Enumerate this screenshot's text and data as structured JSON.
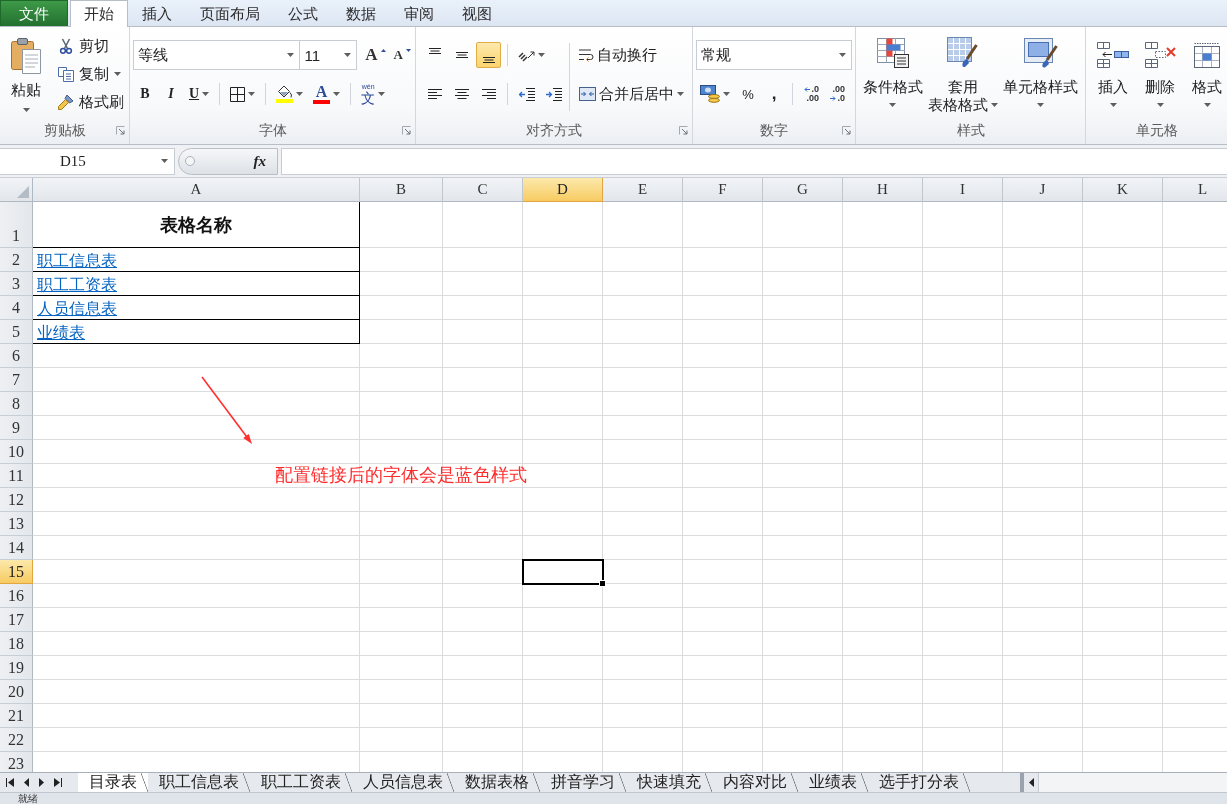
{
  "menu_tabs": [
    {
      "label": "文件",
      "kind": "file",
      "selected": false
    },
    {
      "label": "开始",
      "kind": "tab",
      "selected": true
    },
    {
      "label": "插入",
      "kind": "tab",
      "selected": false
    },
    {
      "label": "页面布局",
      "kind": "tab",
      "selected": false
    },
    {
      "label": "公式",
      "kind": "tab",
      "selected": false
    },
    {
      "label": "数据",
      "kind": "tab",
      "selected": false
    },
    {
      "label": "审阅",
      "kind": "tab",
      "selected": false
    },
    {
      "label": "视图",
      "kind": "tab",
      "selected": false
    }
  ],
  "ribbon": {
    "clipboard": {
      "label": "剪贴板",
      "paste": "粘贴",
      "small_buttons": [
        {
          "kind": "cut",
          "label": "剪切"
        },
        {
          "kind": "copy",
          "label": "复制",
          "dropdown": true
        },
        {
          "kind": "format_painter",
          "label": "格式刷"
        }
      ]
    },
    "font": {
      "label": "字体",
      "font_name": "等线",
      "font_size": "11",
      "size_buttons": [
        {
          "kind": "grow",
          "glyph": "A"
        },
        {
          "kind": "shrink",
          "glyph": "A"
        }
      ],
      "style_buttons": [
        {
          "kind": "bold",
          "glyph": "B"
        },
        {
          "kind": "italic",
          "glyph": "I"
        },
        {
          "kind": "underline",
          "glyph": "U",
          "dropdown": true
        }
      ],
      "color_buttons": [
        {
          "kind": "fill",
          "color": "#ffff00"
        },
        {
          "kind": "font",
          "glyph": "A",
          "color": "#ff0000"
        }
      ],
      "phonetic": {
        "ruby": "wén",
        "glyph": "文"
      }
    },
    "alignment": {
      "label": "对齐方式",
      "vertical": [
        {
          "kind": "top",
          "selected": false
        },
        {
          "kind": "middle",
          "selected": false
        },
        {
          "kind": "bottom",
          "selected": true
        }
      ],
      "horizontal": [
        {
          "kind": "left",
          "selected": false
        },
        {
          "kind": "center",
          "selected": false
        },
        {
          "kind": "right",
          "selected": false
        }
      ],
      "wrap_text": "自动换行",
      "merge_center": "合并后居中"
    },
    "number": {
      "label": "数字",
      "format": "常规",
      "symbol_buttons": [
        {
          "kind": "percent",
          "glyph": "%"
        },
        {
          "kind": "comma",
          "glyph": ","
        }
      ],
      "decimal_buttons": [
        {
          "kind": "increase",
          "lines": [
            ".0",
            ".00"
          ]
        },
        {
          "kind": "decrease",
          "lines": [
            ".00",
            ".0"
          ]
        }
      ]
    },
    "styles": {
      "label": "样式",
      "buttons": [
        {
          "kind": "conditional",
          "lines": [
            "条件格式"
          ],
          "dropdown": true
        },
        {
          "kind": "table",
          "lines": [
            "套用",
            "表格格式"
          ],
          "dropdown": true
        },
        {
          "kind": "cell_styles",
          "lines": [
            "单元格样式"
          ],
          "dropdown": true
        }
      ]
    },
    "cells": {
      "label": "单元格",
      "buttons": [
        {
          "kind": "insert",
          "lines": [
            "插入"
          ],
          "dropdown": true
        },
        {
          "kind": "delete",
          "lines": [
            "删除"
          ],
          "dropdown": true
        },
        {
          "kind": "format",
          "lines": [
            "格式"
          ],
          "dropdown": true
        }
      ]
    }
  },
  "formula_bar": {
    "name_box": "D15",
    "function_button": "fx"
  },
  "sheet": {
    "columns": [
      {
        "label": "A",
        "selected": false
      },
      {
        "label": "B",
        "selected": false
      },
      {
        "label": "C",
        "selected": false
      },
      {
        "label": "D",
        "selected": true
      },
      {
        "label": "E",
        "selected": false
      },
      {
        "label": "F",
        "selected": false
      },
      {
        "label": "G",
        "selected": false
      },
      {
        "label": "H",
        "selected": false
      },
      {
        "label": "I",
        "selected": false
      },
      {
        "label": "J",
        "selected": false
      },
      {
        "label": "K",
        "selected": false
      },
      {
        "label": "L",
        "selected": false
      }
    ],
    "rows": [
      {
        "label": "1",
        "selected": false,
        "cells": [
          {
            "kind": "title",
            "text": "表格名称"
          }
        ]
      },
      {
        "label": "2",
        "selected": false,
        "cells": [
          {
            "kind": "link",
            "text": "职工信息表"
          }
        ]
      },
      {
        "label": "3",
        "selected": false,
        "cells": [
          {
            "kind": "link",
            "text": "职工工资表"
          }
        ]
      },
      {
        "label": "4",
        "selected": false,
        "cells": [
          {
            "kind": "link",
            "text": "人员信息表"
          }
        ]
      },
      {
        "label": "5",
        "selected": false,
        "cells": [
          {
            "kind": "link",
            "text": "业绩表"
          }
        ]
      },
      {
        "label": "6",
        "selected": false
      },
      {
        "label": "7",
        "selected": false
      },
      {
        "label": "8",
        "selected": false
      },
      {
        "label": "9",
        "selected": false
      },
      {
        "label": "10",
        "selected": false
      },
      {
        "label": "11",
        "selected": false
      },
      {
        "label": "12",
        "selected": false
      },
      {
        "label": "13",
        "selected": false
      },
      {
        "label": "14",
        "selected": false
      },
      {
        "label": "15",
        "selected": true
      },
      {
        "label": "16",
        "selected": false
      },
      {
        "label": "17",
        "selected": false
      },
      {
        "label": "18",
        "selected": false
      },
      {
        "label": "19",
        "selected": false
      },
      {
        "label": "20",
        "selected": false
      },
      {
        "label": "21",
        "selected": false
      },
      {
        "label": "22",
        "selected": false
      },
      {
        "label": "23",
        "selected": false
      }
    ]
  },
  "annotation": {
    "text": "配置链接后的字体会是蓝色样式"
  },
  "sheet_tabs": [
    {
      "label": "目录表",
      "selected": true
    },
    {
      "label": "职工信息表",
      "selected": false
    },
    {
      "label": "职工工资表",
      "selected": false
    },
    {
      "label": "人员信息表",
      "selected": false
    },
    {
      "label": "数据表格",
      "selected": false
    },
    {
      "label": "拼音学习",
      "selected": false
    },
    {
      "label": "快速填充",
      "selected": false
    },
    {
      "label": "内容对比",
      "selected": false
    },
    {
      "label": "业绩表",
      "selected": false
    },
    {
      "label": "选手打分表",
      "selected": false
    }
  ],
  "status_bar": {
    "text": "就绪"
  }
}
